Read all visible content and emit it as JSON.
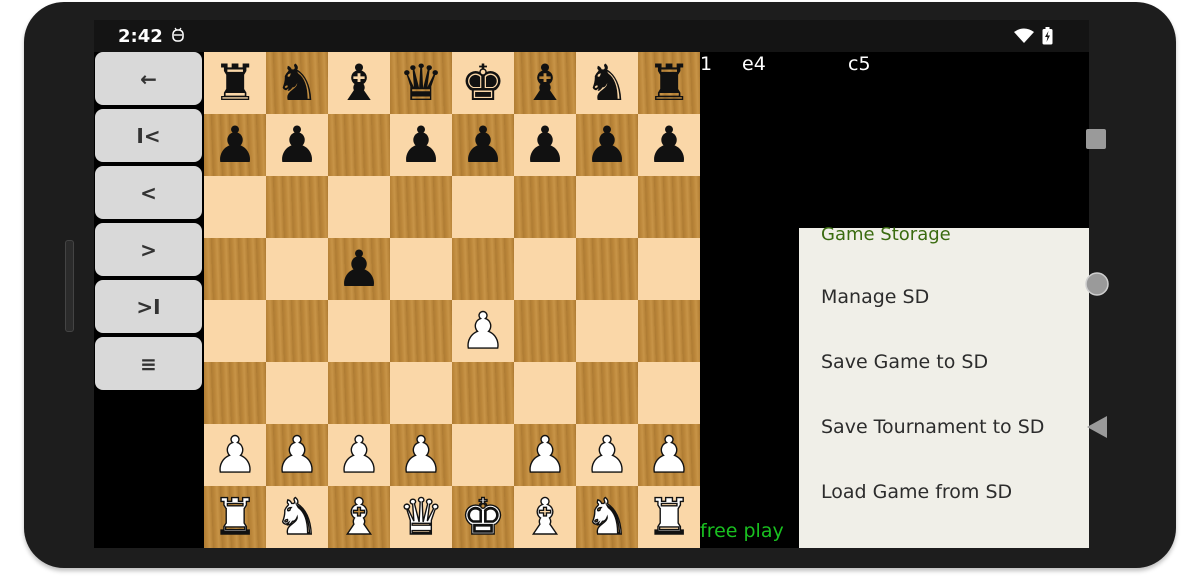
{
  "statusbar": {
    "time": "2:42",
    "app_icon": "droid-badge-icon",
    "wifi_icon": "wifi-icon",
    "battery_icon": "battery-charging-icon"
  },
  "nav_buttons": [
    {
      "name": "back-arrow-button",
      "glyph": "←"
    },
    {
      "name": "first-move-button",
      "glyph": "I<"
    },
    {
      "name": "prev-move-button",
      "glyph": "<"
    },
    {
      "name": "next-move-button",
      "glyph": ">"
    },
    {
      "name": "last-move-button",
      "glyph": ">I"
    },
    {
      "name": "menu-button",
      "glyph": "≡"
    }
  ],
  "board": {
    "light_color": "#fad7a8",
    "dark_color": "#c08a3c",
    "ranks": [
      [
        "r",
        "n",
        "b",
        "q",
        "k",
        "b",
        "n",
        "r"
      ],
      [
        "p",
        "p",
        "",
        "p",
        "p",
        "p",
        "p",
        "p"
      ],
      [
        "",
        "",
        "",
        "",
        "",
        "",
        "",
        ""
      ],
      [
        "",
        "",
        "p",
        "",
        "",
        "",
        "",
        ""
      ],
      [
        "",
        "",
        "",
        "",
        "P",
        "",
        "",
        ""
      ],
      [
        "",
        "",
        "",
        "",
        "",
        "",
        "",
        ""
      ],
      [
        "P",
        "P",
        "P",
        "P",
        "",
        "P",
        "P",
        "P"
      ],
      [
        "R",
        "N",
        "B",
        "Q",
        "K",
        "B",
        "N",
        "R"
      ]
    ]
  },
  "moves": {
    "number": "1",
    "white": "e4",
    "black": "c5"
  },
  "status_text": "free play",
  "menu": {
    "title": "Game Storage",
    "items": [
      "Manage SD",
      "Save Game to SD",
      "Save Tournament to SD",
      "Load Game from SD"
    ]
  },
  "colors": {
    "menu_title": "#3a6b10",
    "free_play": "#19c020",
    "menu_bg": "#f0efe8"
  }
}
